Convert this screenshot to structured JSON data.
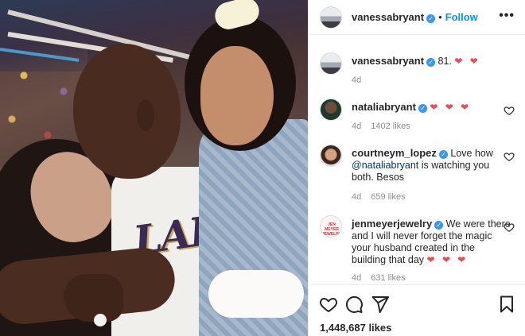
{
  "post": {
    "author": "vanessabryant",
    "follow_label": "Follow",
    "separator": "•",
    "more_label": "•••",
    "likes": "1,448,687 likes"
  },
  "comments": [
    {
      "user": "vanessabryant",
      "text": "81.",
      "hearts": "❤ ❤",
      "age": "4d",
      "likes": ""
    },
    {
      "user": "nataliabryant",
      "text": "",
      "hearts": "❤ ❤ ❤",
      "age": "4d",
      "likes": "1402 likes"
    },
    {
      "user": "courtneym_lopez",
      "text_before": "Love how",
      "mention": "@nataliabryant",
      "text_after": "is watching you both. Besos",
      "age": "4d",
      "likes": "659 likes"
    },
    {
      "user": "jenmeyerjewelry",
      "text": "We were there and I will never forget the magic your husband created in the building that day",
      "hearts": "❤ ❤ ❤",
      "age": "4d",
      "likes": "631 likes",
      "avatar_text": "JEN MEYER JEWELRY"
    }
  ],
  "photo": {
    "jersey_text": "LAK"
  },
  "icons": {
    "verified": "verified-badge-icon",
    "like": "heart-outline-icon",
    "comment": "speech-bubble-icon",
    "share": "paper-plane-icon",
    "save": "bookmark-icon"
  },
  "colors": {
    "follow": "#0095f6",
    "verified": "#3897f0",
    "heart": "#ed4956",
    "meta": "#8e8e8e"
  }
}
